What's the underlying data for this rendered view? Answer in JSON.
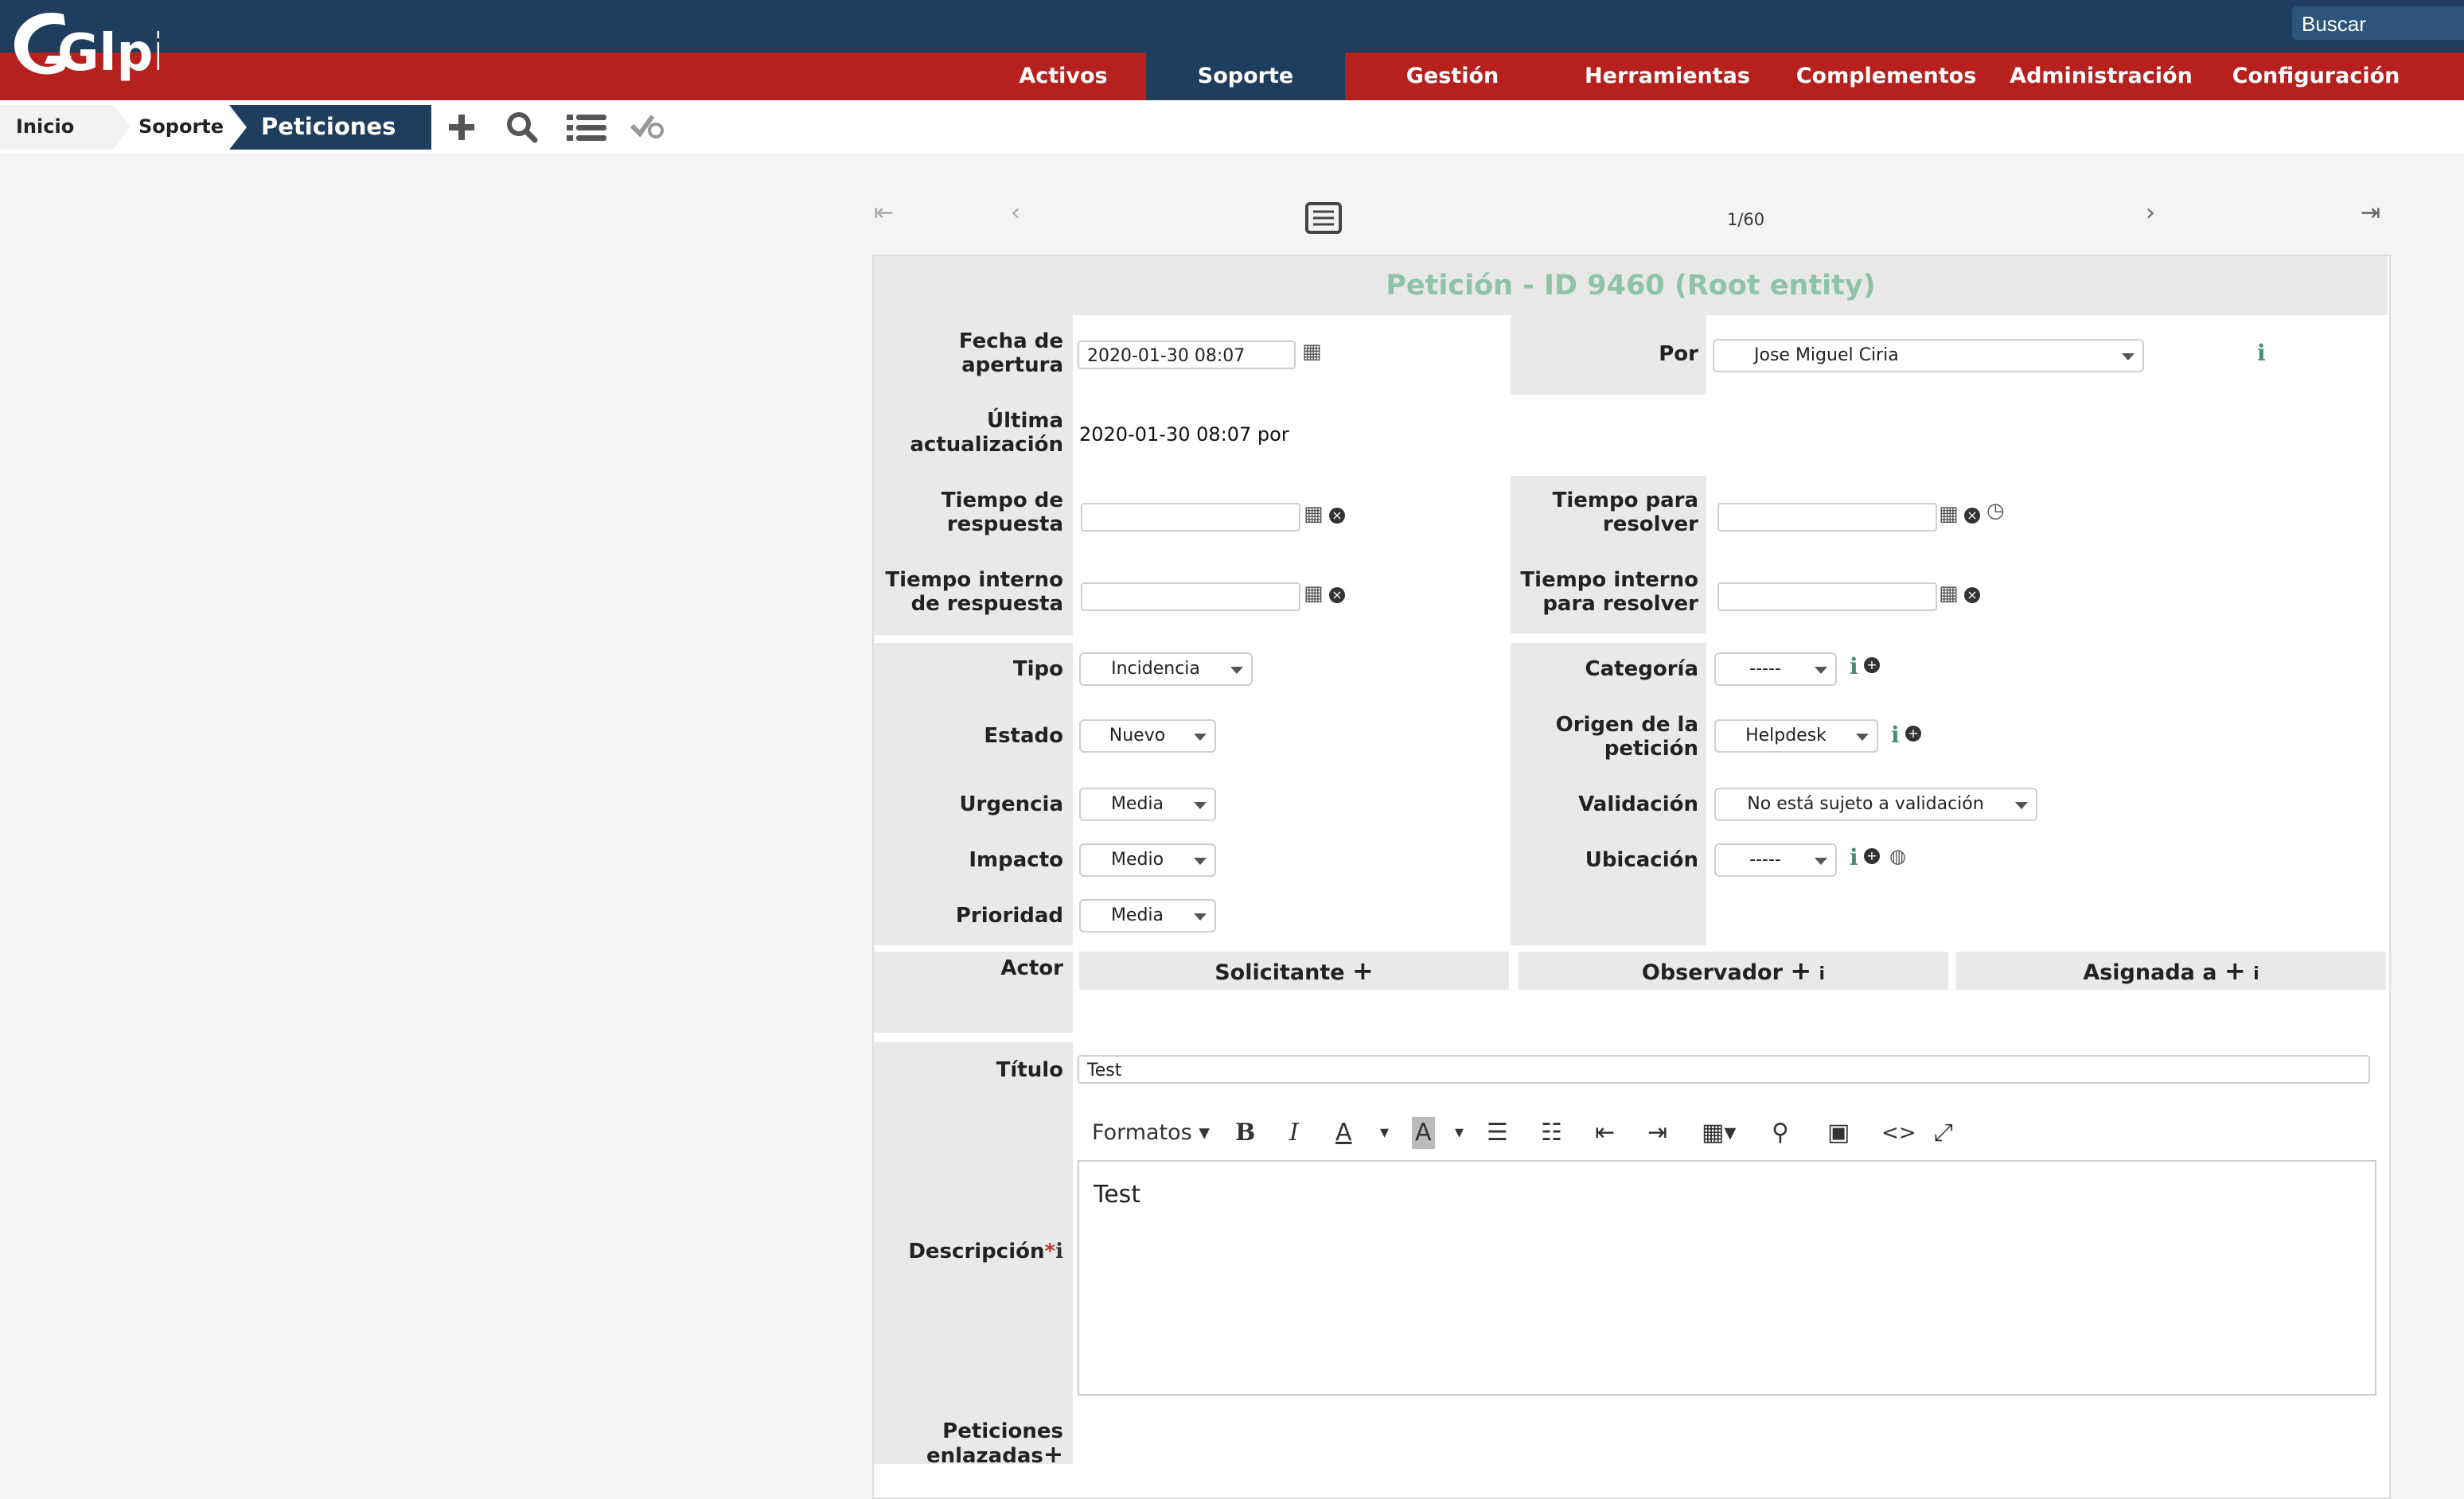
{
  "app": {
    "logo_text": "Glpi",
    "search_label": "Buscar"
  },
  "nav": {
    "items": [
      "Activos",
      "Soporte",
      "Gestión",
      "Herramientas",
      "Complementos",
      "Administración",
      "Configuración"
    ],
    "active": "Soporte"
  },
  "breadcrumb": [
    "Inicio",
    "Soporte",
    "Peticiones"
  ],
  "toolbar_icons": [
    "add-icon",
    "search-icon",
    "list-icon",
    "validate-icon"
  ],
  "pager": {
    "count": "1/60"
  },
  "form": {
    "title": "Petición - ID 9460 (Root entity)",
    "fecha_apertura": {
      "label_1": "Fecha de",
      "label_2": "apertura",
      "value": "2020-01-30 08:07"
    },
    "ultima": {
      "label_1": "Última",
      "label_2": "actualización",
      "value": "2020-01-30 08:07 por"
    },
    "por": {
      "label": "Por",
      "value": "Jose Miguel Ciria"
    },
    "tiempo_respuesta": {
      "label_1": "Tiempo de",
      "label_2": "respuesta",
      "value": ""
    },
    "tiempo_resolver": {
      "label_1": "Tiempo para",
      "label_2": "resolver",
      "value": ""
    },
    "tiempo_interno_respuesta": {
      "label_1": "Tiempo interno",
      "label_2": "de respuesta",
      "value": ""
    },
    "tiempo_interno_resolver": {
      "label_1": "Tiempo interno",
      "label_2": "para resolver",
      "value": ""
    },
    "tipo": {
      "label": "Tipo",
      "value": "Incidencia"
    },
    "categoria": {
      "label": "Categoría",
      "value": "-----"
    },
    "estado": {
      "label": "Estado",
      "value": "Nuevo"
    },
    "origen": {
      "label_1": "Origen de la",
      "label_2": "petición",
      "value": "Helpdesk"
    },
    "urgencia": {
      "label": "Urgencia",
      "value": "Media"
    },
    "validacion": {
      "label": "Validación",
      "value": "No está sujeto a validación"
    },
    "impacto": {
      "label": "Impacto",
      "value": "Medio"
    },
    "ubicacion": {
      "label": "Ubicación",
      "value": "-----"
    },
    "prioridad": {
      "label": "Prioridad",
      "value": "Media"
    },
    "actor": {
      "label": "Actor",
      "columns": [
        "Solicitante",
        "Observador",
        "Asignada a"
      ]
    },
    "titulo": {
      "label": "Título",
      "value": "Test"
    },
    "descripcion": {
      "label": "Descripción",
      "required_mark": "*",
      "value": "Test",
      "formats_label": "Formatos"
    },
    "peticiones_enlazadas": {
      "label_1": "Peticiones",
      "label_2": "enlazadas"
    }
  },
  "colors": {
    "top_blue": "#1f3e5e",
    "nav_red": "#b6211d",
    "title_green": "#8ec3a7"
  }
}
